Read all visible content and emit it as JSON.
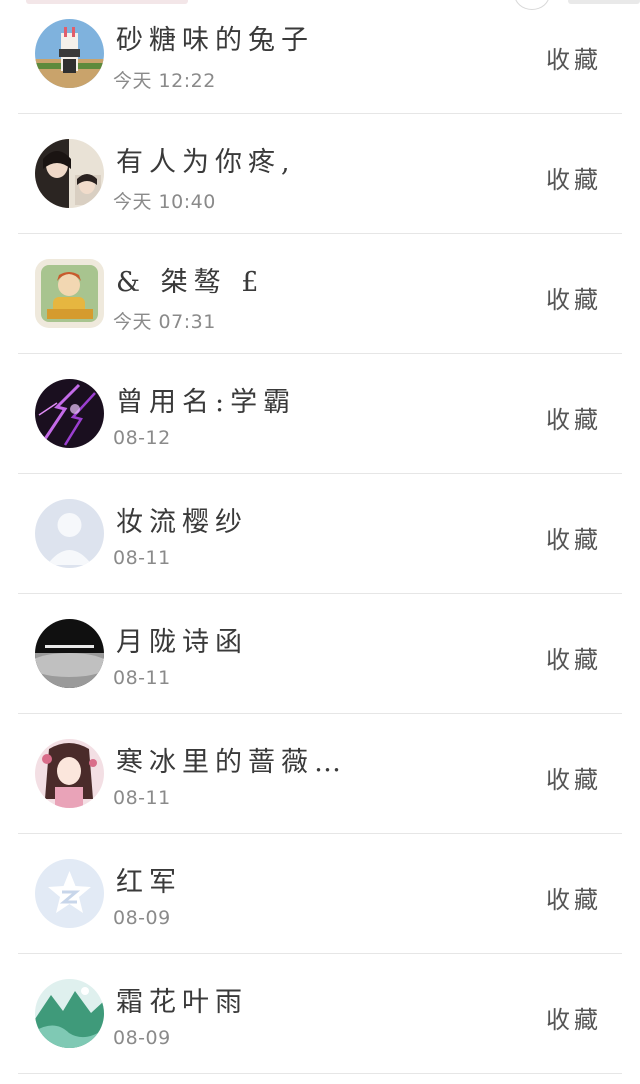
{
  "contacts": [
    {
      "name": "砂糖味的兔子",
      "time": "今天 12:22",
      "action": "收藏",
      "avatar": "avatar-rabbit-castle"
    },
    {
      "name": "有人为你疼,",
      "time": "今天 10:40",
      "action": "收藏",
      "avatar": "avatar-couple-photo"
    },
    {
      "name": "& 桀骜 £",
      "time": "今天 07:31",
      "action": "收藏",
      "avatar": "avatar-cartoon-queen"
    },
    {
      "name": "曾用名:学霸",
      "time": "08-12",
      "action": "收藏",
      "avatar": "avatar-purple-lightning"
    },
    {
      "name": "妆流樱纱",
      "time": "08-11",
      "action": "收藏",
      "avatar": "avatar-default-silhouette"
    },
    {
      "name": "月陇诗函",
      "time": "08-11",
      "action": "收藏",
      "avatar": "avatar-dark-mist"
    },
    {
      "name": "寒冰里的蔷薇…",
      "time": "08-11",
      "action": "收藏",
      "avatar": "avatar-anime-girl"
    },
    {
      "name": "红军",
      "time": "08-09",
      "action": "收藏",
      "avatar": "avatar-qzone-star"
    },
    {
      "name": "霜花叶雨",
      "time": "08-09",
      "action": "收藏",
      "avatar": "avatar-green-landscape"
    }
  ],
  "colors": {
    "text_primary": "#3a3a3a",
    "text_secondary": "#8a8a8a",
    "divider": "#e6e6e6"
  }
}
